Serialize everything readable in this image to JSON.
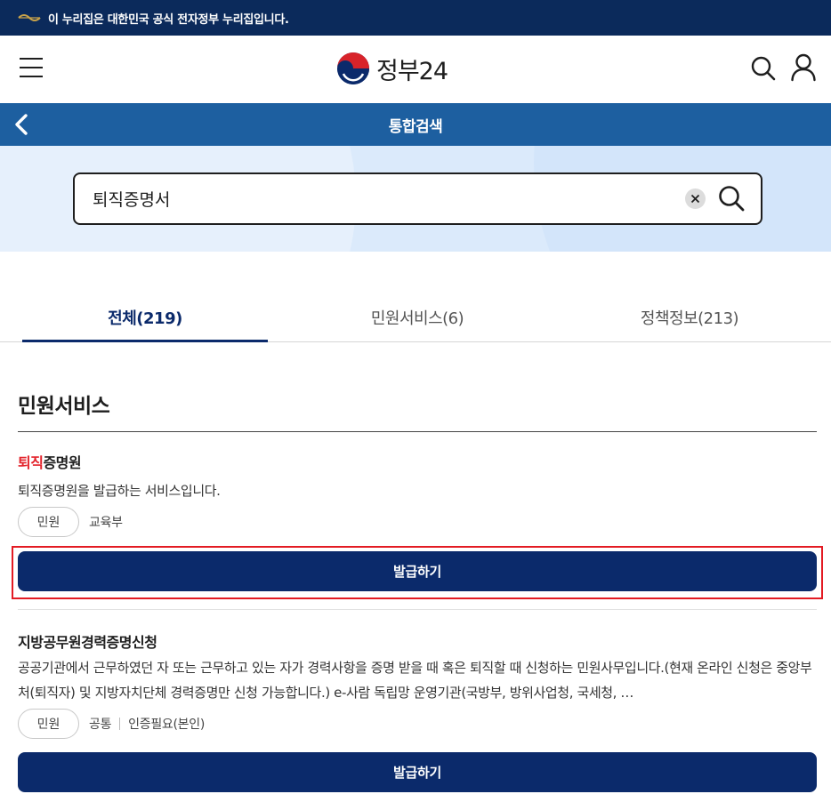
{
  "gov_banner": {
    "text": "이 누리집은 대한민국 공식 전자정부 누리집입니다."
  },
  "header": {
    "logo_text": "정부24"
  },
  "title_bar": {
    "title": "통합검색"
  },
  "search": {
    "value": "퇴직증명서"
  },
  "tabs": [
    {
      "label": "전체(219)",
      "active": true
    },
    {
      "label": "민원서비스(6)",
      "active": false
    },
    {
      "label": "정책정보(213)",
      "active": false
    }
  ],
  "section": {
    "title": "민원서비스"
  },
  "results": [
    {
      "title_highlight": "퇴직",
      "title_rest": "증명원",
      "description": "퇴직증명원을 발급하는 서비스입니다.",
      "tag": "민원",
      "meta": [
        "교육부"
      ],
      "button_label": "발급하기"
    },
    {
      "title_highlight": "",
      "title_rest": "지방공무원경력증명신청",
      "description": "공공기관에서 근무하였던 자 또는 근무하고 있는 자가 경력사항을 증명 받을 때 혹은 퇴직할 때 신청하는 민원사무입니다.(현재 온라인 신청은 중앙부처(퇴직자) 및 지방자치단체 경력증명만 신청 가능합니다.) e-사람 독립망 운영기관(국방부, 방위사업청, 국세청, …",
      "tag": "민원",
      "meta": [
        "공통",
        "인증필요(본인)"
      ],
      "button_label": "발급하기"
    }
  ],
  "colors": {
    "banner": "#0b2a5b",
    "title_bar": "#1d5fa0",
    "primary": "#0b2a6b",
    "highlight": "#e3232b",
    "annotation_box": "#e31b23"
  }
}
